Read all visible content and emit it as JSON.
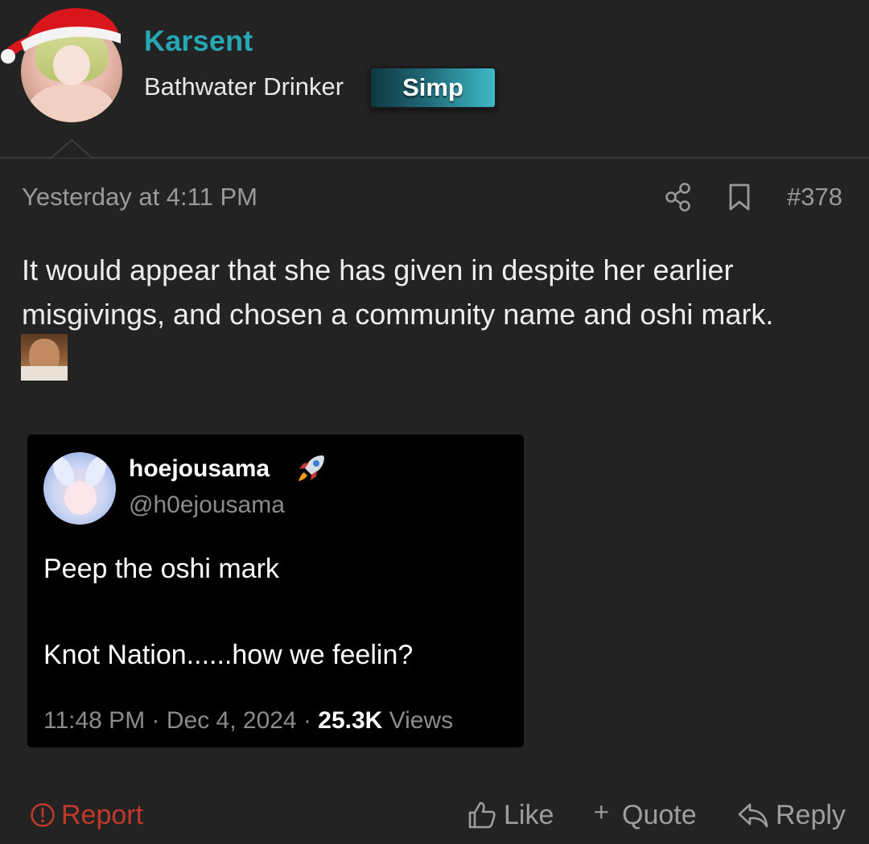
{
  "user": {
    "name": "Karsent",
    "title": "Bathwater Drinker",
    "badge": "Simp"
  },
  "post": {
    "time": "Yesterday at 4:11 PM",
    "number": "#378",
    "text": "It would appear that she has given in despite her earlier misgivings, and chosen a community name and oshi mark."
  },
  "tweet": {
    "name": "hoejousama",
    "handle": "@h0ejousama",
    "line1": "Peep the oshi mark",
    "line2": "Knot Nation......how we feelin?",
    "time": "11:48 PM · Dec 4, 2024 · ",
    "views_count": "25.3K",
    "views_label": " Views"
  },
  "actions": {
    "report": "Report",
    "like": "Like",
    "quote": "Quote",
    "reply": "Reply"
  },
  "colors": {
    "background": "#232323",
    "username": "#27a7b4",
    "report": "#c0392b",
    "muted": "#9a9a9a"
  }
}
